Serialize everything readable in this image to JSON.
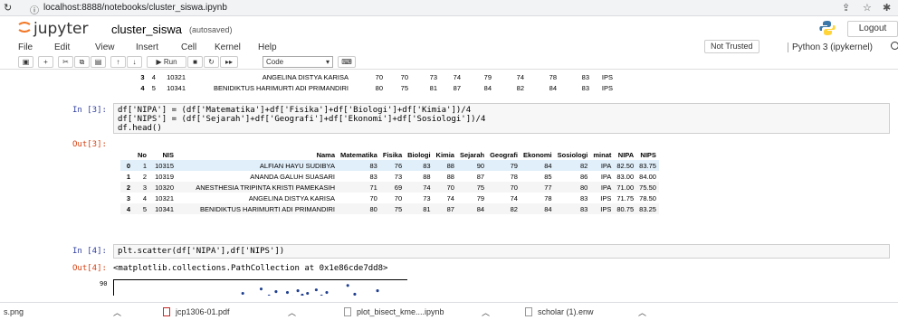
{
  "browser": {
    "nav_icon": "↻",
    "info_icon": "ⓘ",
    "url": "localhost:8888/notebooks/cluster_siswa.ipynb",
    "right_icons": [
      "share-icon",
      "star-icon",
      "extension-icon"
    ]
  },
  "header": {
    "logo_text": "jupyter",
    "notebook_name": "cluster_siswa",
    "autosave": "(autosaved)",
    "logout_label": "Logout"
  },
  "menu": {
    "items": [
      "File",
      "Edit",
      "View",
      "Insert",
      "Cell",
      "Kernel",
      "Help"
    ],
    "trust": "Not Trusted",
    "kernel": "Python 3 (ipykernel)"
  },
  "toolbar": {
    "run_label": "▶ Run",
    "cell_type": "Code"
  },
  "cells": {
    "prev_rows": [
      [
        "3",
        "4",
        "10321",
        "ANGELINA DISTYA KARISA",
        "70",
        "70",
        "73",
        "74",
        "79",
        "74",
        "78",
        "83",
        "IPS"
      ],
      [
        "4",
        "5",
        "10341",
        "BENIDIKTUS HARIMURTI ADI PRIMANDIRI",
        "80",
        "75",
        "81",
        "87",
        "84",
        "82",
        "84",
        "83",
        "IPS"
      ]
    ],
    "in3_prompt": "In [3]:",
    "in3_code": "df['NIPA'] = (df['Matematika']+df['Fisika']+df['Biologi']+df['Kimia'])/4\ndf['NIPS'] = (df['Sejarah']+df['Geografi']+df['Ekonomi']+df['Sosiologi'])/4\ndf.head()",
    "out3_prompt": "Out[3]:",
    "table": {
      "columns": [
        "",
        "No",
        "NIS",
        "Nama",
        "Matematika",
        "Fisika",
        "Biologi",
        "Kimia",
        "Sejarah",
        "Geografi",
        "Ekonomi",
        "Sosiologi",
        "minat",
        "NIPA",
        "NIPS"
      ],
      "rows": [
        [
          "0",
          "1",
          "10315",
          "ALFIAN HAYU SUDIBYA",
          "83",
          "76",
          "83",
          "88",
          "90",
          "79",
          "84",
          "82",
          "IPA",
          "82.50",
          "83.75"
        ],
        [
          "1",
          "2",
          "10319",
          "ANANDA GALUH SUASARI",
          "83",
          "73",
          "88",
          "88",
          "87",
          "78",
          "85",
          "86",
          "IPA",
          "83.00",
          "84.00"
        ],
        [
          "2",
          "3",
          "10320",
          "ANESTHESIA TRIPINTA KRISTI PAMEKASIH",
          "71",
          "69",
          "74",
          "70",
          "75",
          "70",
          "77",
          "80",
          "IPA",
          "71.00",
          "75.50"
        ],
        [
          "3",
          "4",
          "10321",
          "ANGELINA DISTYA KARISA",
          "70",
          "70",
          "73",
          "74",
          "79",
          "74",
          "78",
          "83",
          "IPS",
          "71.75",
          "78.50"
        ],
        [
          "4",
          "5",
          "10341",
          "BENIDIKTUS HARIMURTI ADI PRIMANDIRI",
          "80",
          "75",
          "81",
          "87",
          "84",
          "82",
          "84",
          "83",
          "IPS",
          "80.75",
          "83.25"
        ]
      ]
    },
    "in4_prompt": "In [4]:",
    "in4_code": "plt.scatter(df['NIPA'],df['NIPS'])",
    "out4_prompt": "Out[4]:",
    "out4_text": "<matplotlib.collections.PathCollection at 0x1e86cde7dd8>",
    "plot_ytick": "90"
  },
  "downloads": {
    "items": [
      "s.png",
      "jcp1306-01.pdf",
      "plot_bisect_kme....ipynb",
      "scholar (1).enw"
    ]
  }
}
